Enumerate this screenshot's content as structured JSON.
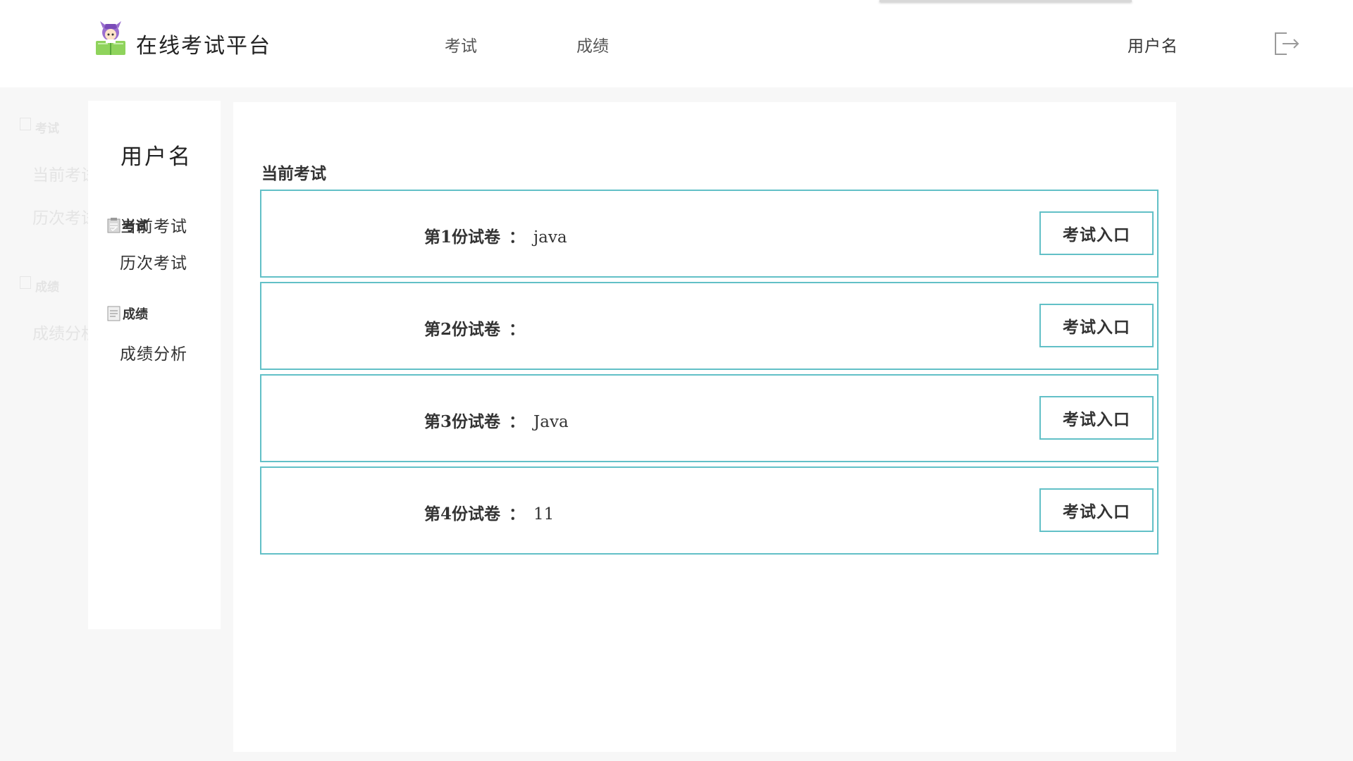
{
  "header": {
    "app_title": "在线考试平台",
    "nav": [
      {
        "label": "考试"
      },
      {
        "label": "成绩"
      }
    ],
    "username": "用户名",
    "logout_icon": "logout-icon"
  },
  "ghost_menu": {
    "group_exam": "考试",
    "item_current": "当前考试",
    "item_history": "历次考试",
    "group_score": "成绩",
    "item_analysis": "成绩分析"
  },
  "sidebar": {
    "username": "用户名",
    "groups": [
      {
        "label": "考试",
        "icon": "exam-doc-icon",
        "items": [
          {
            "label": "当前考试"
          },
          {
            "label": "历次考试"
          }
        ]
      },
      {
        "label": "成绩",
        "icon": "score-doc-icon",
        "items": [
          {
            "label": "成绩分析"
          }
        ]
      }
    ]
  },
  "main": {
    "title": "当前考试",
    "separator": "：",
    "exams": [
      {
        "label": "第1份试卷",
        "name": "java",
        "button": "考试入口"
      },
      {
        "label": "第2份试卷",
        "name": "",
        "button": "考试入口"
      },
      {
        "label": "第3份试卷",
        "name": "Java",
        "button": "考试入口"
      },
      {
        "label": "第4份试卷",
        "name": "11",
        "button": "考试入口"
      }
    ]
  },
  "colors": {
    "accent_border": "#62c0c7",
    "page_bg": "#f7f7f7",
    "panel_bg": "#ffffff"
  }
}
